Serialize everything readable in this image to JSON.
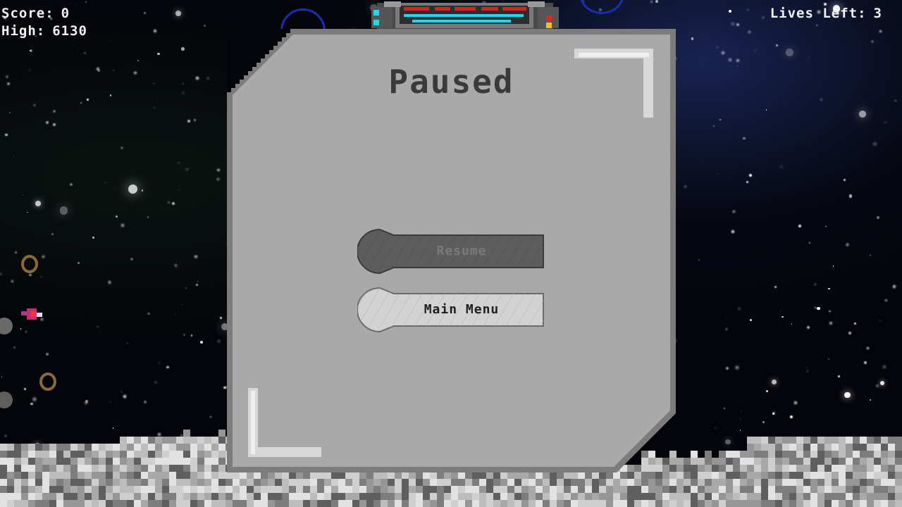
{
  "hud": {
    "score_label": "Score:",
    "score_value": "0",
    "high_label": "High:",
    "high_value": "6130",
    "lives_label": "Lives Left:",
    "lives_value": "3"
  },
  "pause_menu": {
    "title": "Paused",
    "buttons": [
      {
        "label": "Resume",
        "state": "disabled"
      },
      {
        "label": "Main Menu",
        "state": "enabled"
      }
    ]
  },
  "colors": {
    "panel_fill": "#a9a9a9",
    "panel_border": "#7c7c7c",
    "title_text": "#3a3a3a",
    "resume_fill": "#5a5a5a",
    "main_menu_fill": "#cfcfcf",
    "hud_text": "#f2f2f2"
  },
  "icons": {
    "player_ship": "player-ship-icon",
    "enemy_ship": "enemy-ship-icon",
    "asteroid": "asteroid-icon"
  }
}
